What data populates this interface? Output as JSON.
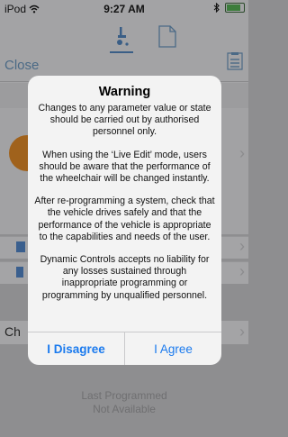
{
  "status_bar": {
    "carrier": "iPod",
    "wifi_icon": "wifi-icon",
    "time": "9:27 AM",
    "bluetooth_icon": "bluetooth-icon",
    "battery_color": "#3c7d3c"
  },
  "nav": {
    "close_label": "Close",
    "tabs": [
      {
        "icon": "wheelchair-icon",
        "selected": true
      },
      {
        "icon": "document-icon",
        "selected": false
      }
    ],
    "right_icon": "list-icon",
    "accent_color": "#3a5e86"
  },
  "background": {
    "row_partial_label": "Ch",
    "last_programmed_label": "Last Programmed",
    "last_programmed_value": "Not Available"
  },
  "alert": {
    "title": "Warning",
    "paragraphs": [
      "Changes to any parameter value or state should be carried out by authorised personnel only.",
      "When using the ‘Live Edit’ mode, users should be aware that the performance of the wheelchair will be changed instantly.",
      "After re-programming a system, check that the vehicle drives safely and that the performance of the vehicle is appropriate to the capabilities and needs of the user.",
      "Dynamic Controls accepts no liability for any losses sustained through inappropriate programming or programming by unqualified personnel."
    ],
    "disagree_label": "I Disagree",
    "agree_label": "I Agree",
    "button_color": "#1a7aee"
  }
}
